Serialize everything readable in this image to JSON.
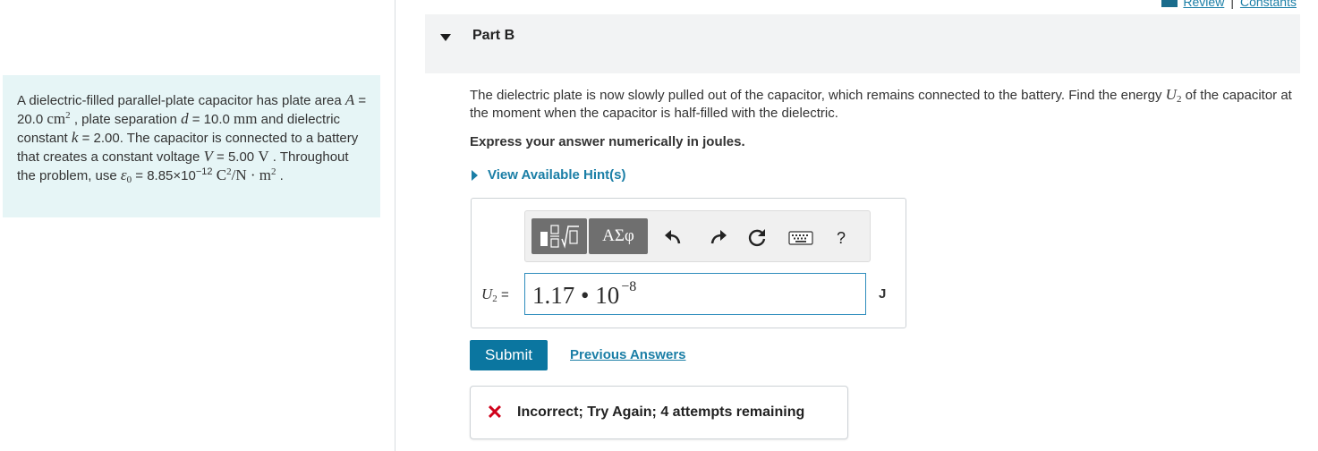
{
  "top_links": {
    "review": "Review",
    "separator": "|",
    "constants": "Constants"
  },
  "problem": {
    "t1": "A dielectric-filled parallel-plate capacitor has plate area ",
    "A_sym": "A",
    "t2": " = 20.0 ",
    "A_unit": "cm",
    "sq": "2",
    "t3": " , plate separation ",
    "d_sym": "d",
    "t4": " = 10.0 ",
    "d_unit": "mm",
    "t5": " and dielectric constant ",
    "k_sym": "k",
    "t6": " = 2.00. The capacitor is connected to a battery that creates a constant voltage ",
    "V_sym": "V",
    "t7": " = 5.00 ",
    "V_unit": "V",
    "t8": " . Throughout the problem, use ",
    "eps_sym": "ε",
    "eps_sub": "0",
    "t9": " = 8.85×10",
    "eps_exp": "−12",
    "t10": " C",
    "t11": "/N · m",
    "t12": " ."
  },
  "part": {
    "title": "Part B"
  },
  "question": {
    "t1": "The dielectric plate is now slowly pulled out of the capacitor, which remains connected to the battery. Find the energy ",
    "U": "U",
    "sub": "2",
    "t2": " of the capacitor at the moment when the capacitor is half-filled with the dielectric."
  },
  "instruction": "Express your answer numerically in joules.",
  "hints": "View Available Hint(s)",
  "toolbar": {
    "greek_label": "ΑΣφ",
    "template_icon": "fraction-sqrt-template-icon",
    "undo_icon": "undo-icon",
    "redo_icon": "redo-icon",
    "reset_icon": "reset-icon",
    "keyboard_icon": "keyboard-icon",
    "help_label": "?"
  },
  "answer": {
    "var": "U",
    "var_sub": "2",
    "eq": " =",
    "value": "1.17 • 10",
    "exponent": "−8",
    "unit": "J"
  },
  "submit_label": "Submit",
  "previous_answers_label": "Previous Answers",
  "feedback": {
    "icon": "✕",
    "text": "Incorrect; Try Again; 4 attempts remaining"
  },
  "colors": {
    "link": "#1a7ea6",
    "submit_bg": "#0b76a0",
    "problem_bg": "#e6f5f6",
    "error": "#d0021b"
  }
}
